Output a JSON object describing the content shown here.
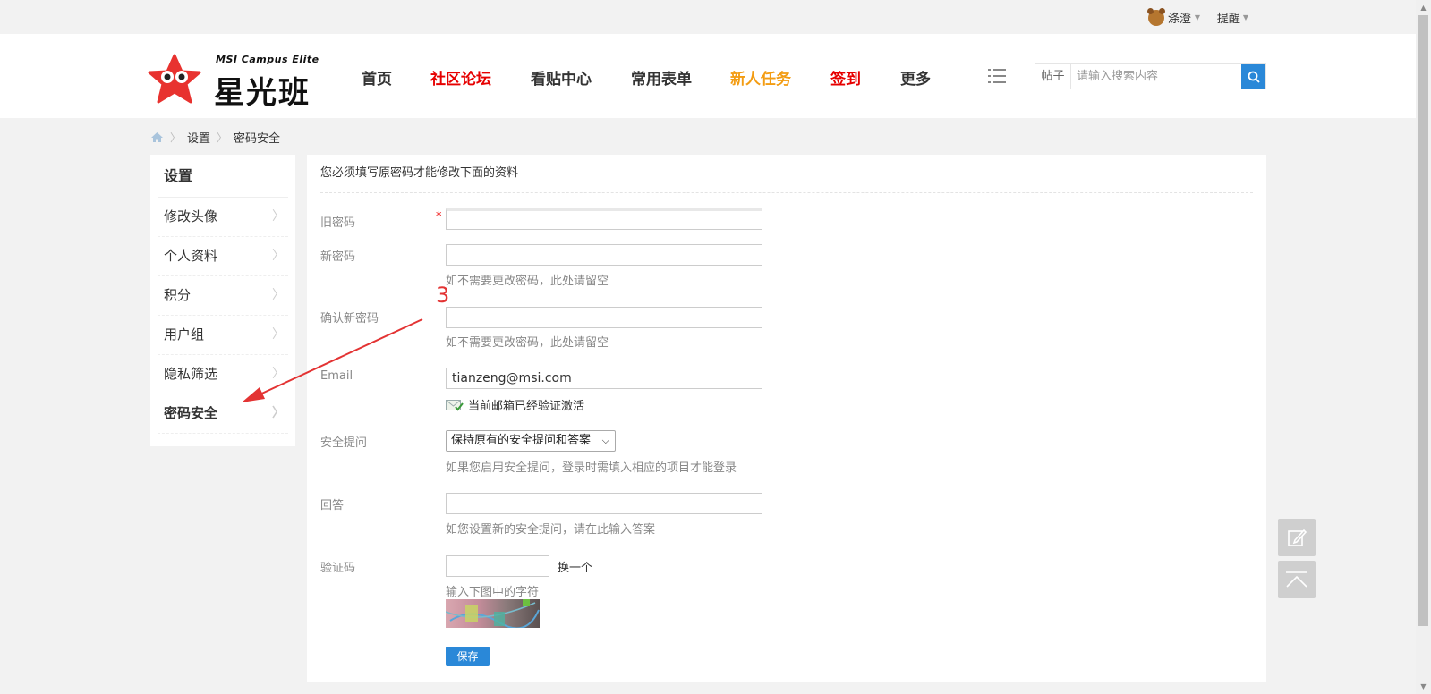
{
  "topbar": {
    "username": "涤澄",
    "remind": "提醒"
  },
  "logo": {
    "en": "MSI Campus Elite",
    "cn": "星光班"
  },
  "nav": [
    {
      "label": "首页",
      "color": "#333333"
    },
    {
      "label": "社区论坛",
      "color": "#e60000"
    },
    {
      "label": "看贴中心",
      "color": "#333333"
    },
    {
      "label": "常用表单",
      "color": "#333333"
    },
    {
      "label": "新人任务",
      "color": "#f39c12"
    },
    {
      "label": "签到",
      "color": "#e60000"
    },
    {
      "label": "更多",
      "color": "#333333"
    }
  ],
  "search": {
    "type": "帖子",
    "placeholder": "请输入搜索内容"
  },
  "breadcrumb": {
    "home_icon": "home-icon",
    "level1": "设置",
    "level2": "密码安全"
  },
  "sidebar": {
    "title": "设置",
    "items": [
      {
        "label": "修改头像",
        "active": false
      },
      {
        "label": "个人资料",
        "active": false
      },
      {
        "label": "积分",
        "active": false
      },
      {
        "label": "用户组",
        "active": false
      },
      {
        "label": "隐私筛选",
        "active": false
      },
      {
        "label": "密码安全",
        "active": true
      }
    ]
  },
  "form": {
    "notice": "您必须填写原密码才能修改下面的资料",
    "old_password_label": "旧密码",
    "required_mark": "*",
    "new_password_label": "新密码",
    "new_password_hint": "如不需要更改密码，此处请留空",
    "confirm_password_label": "确认新密码",
    "confirm_password_hint": "如不需要更改密码，此处请留空",
    "email_label": "Email",
    "email_value": "tianzeng@msi.com",
    "email_status": "当前邮箱已经验证激活",
    "security_question_label": "安全提问",
    "security_question_value": "保持原有的安全提问和答案",
    "security_question_hint": "如果您启用安全提问，登录时需填入相应的项目才能登录",
    "answer_label": "回答",
    "answer_hint": "如您设置新的安全提问，请在此输入答案",
    "captcha_label": "验证码",
    "captcha_change": "换一个",
    "captcha_hint": "输入下图中的字符",
    "save_button": "保存"
  },
  "annotation": {
    "number": "3",
    "color": "#e33333"
  },
  "float_buttons": [
    "edit-icon",
    "back-to-top-icon"
  ],
  "accent_color": "#2a88d8"
}
